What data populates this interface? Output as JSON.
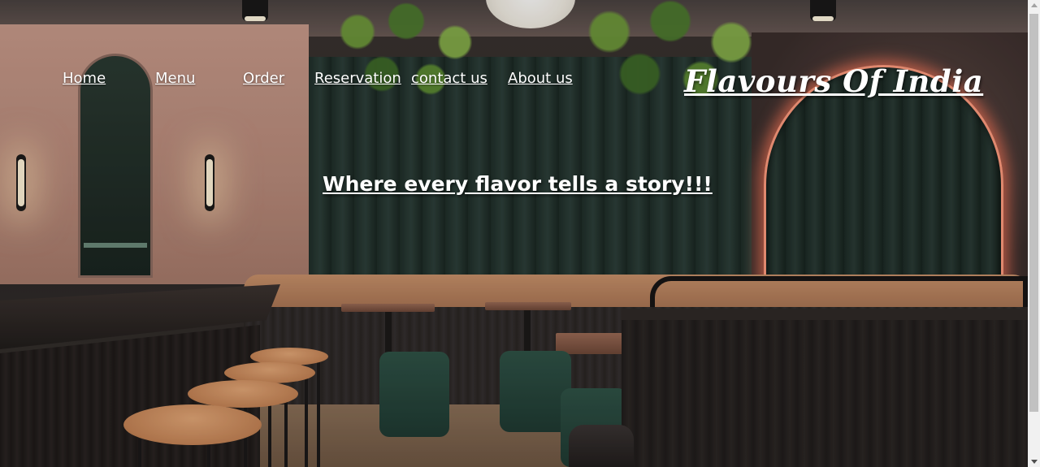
{
  "nav": {
    "items": [
      {
        "label": "Home"
      },
      {
        "label": "Menu"
      },
      {
        "label": "Order"
      },
      {
        "label": "Reservation"
      },
      {
        "label": "contact us"
      },
      {
        "label": "About us"
      }
    ]
  },
  "brand": {
    "title": "Flavours Of India"
  },
  "hero": {
    "tagline": "Where every flavor tells a story!!!"
  },
  "colors": {
    "text": "#ffffff",
    "scrollbar_track": "#f1f1f1",
    "scrollbar_thumb": "#c1c1c1"
  }
}
